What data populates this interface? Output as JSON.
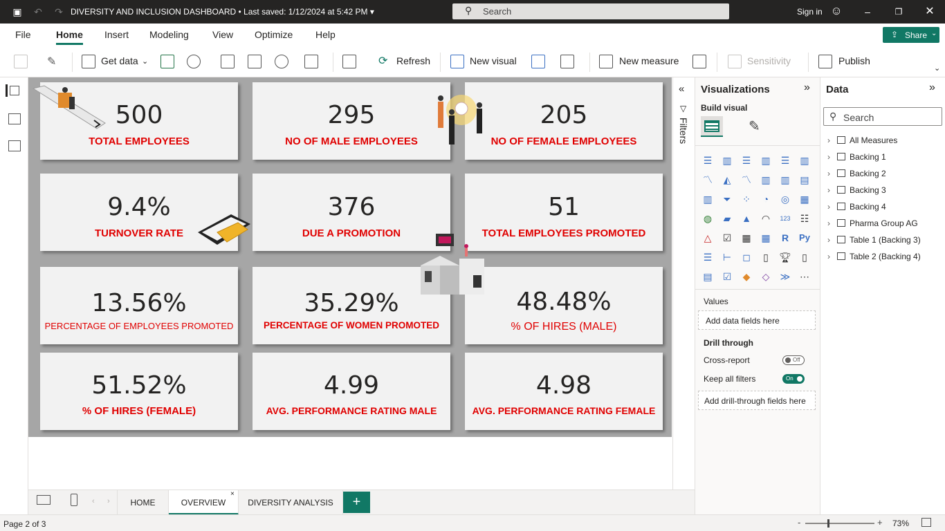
{
  "titlebar": {
    "title": "DIVERSITY AND INCLUSION DASHBOARD",
    "saved": "• Last saved: 1/12/2024 at 5:42 PM",
    "search_placeholder": "Search",
    "sign_in": "Sign in"
  },
  "menu": {
    "items": [
      "File",
      "Home",
      "Insert",
      "Modeling",
      "View",
      "Optimize",
      "Help"
    ],
    "active": "Home",
    "share": "Share"
  },
  "ribbon": {
    "get_data": "Get data",
    "refresh": "Refresh",
    "new_visual": "New visual",
    "new_measure": "New measure",
    "sensitivity": "Sensitivity",
    "publish": "Publish"
  },
  "cards": [
    {
      "value": "500",
      "label": "TOTAL EMPLOYEES"
    },
    {
      "value": "295",
      "label": "NO OF MALE EMPLOYEES"
    },
    {
      "value": "205",
      "label": "NO OF FEMALE EMPLOYEES"
    },
    {
      "value": "9.4%",
      "label": "TURNOVER RATE"
    },
    {
      "value": "376",
      "label": "DUE A PROMOTION"
    },
    {
      "value": "51",
      "label": "TOTAL EMPLOYEES PROMOTED"
    },
    {
      "value": "13.56%",
      "label": "PERCENTAGE OF EMPLOYEES PROMOTED"
    },
    {
      "value": "35.29%",
      "label": "PERCENTAGE OF WOMEN PROMOTED"
    },
    {
      "value": "48.48%",
      "label": "% OF HIRES (MALE)"
    },
    {
      "value": "51.52%",
      "label": "% OF HIRES (FEMALE)"
    },
    {
      "value": "4.99",
      "label": "AVG. PERFORMANCE RATING MALE"
    },
    {
      "value": "4.98",
      "label": "AVG. PERFORMANCE RATING FEMALE"
    }
  ],
  "filters": {
    "label": "Filters"
  },
  "visualizations": {
    "title": "Visualizations",
    "build_visual": "Build visual",
    "values_label": "Values",
    "values_placeholder": "Add data fields here",
    "drill_through": "Drill through",
    "cross_report": "Cross-report",
    "cross_report_state": "Off",
    "keep_all_filters": "Keep all filters",
    "keep_all_filters_state": "On",
    "drill_placeholder": "Add drill-through fields here"
  },
  "data_pane": {
    "title": "Data",
    "search_placeholder": "Search",
    "items": [
      "All Measures",
      "Backing 1",
      "Backing 2",
      "Backing 3",
      "Backing 4",
      "Pharma Group AG",
      "Table 1 (Backing 3)",
      "Table 2 (Backing 4)"
    ]
  },
  "pages": {
    "tabs": [
      "HOME",
      "OVERVIEW",
      "DIVERSITY ANALYSIS"
    ],
    "active": "OVERVIEW"
  },
  "status": {
    "page": "Page 2 of 3",
    "zoom": "73%"
  },
  "colors": {
    "accent": "#117865",
    "card_label": "#e00000",
    "report_background": "#a6a6a6"
  }
}
